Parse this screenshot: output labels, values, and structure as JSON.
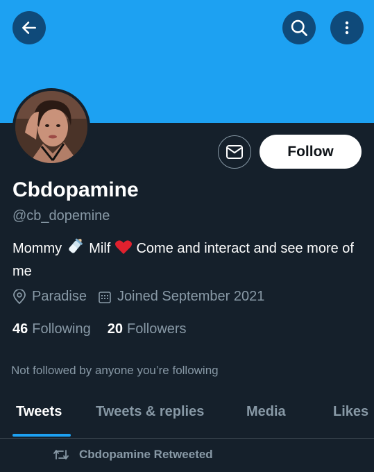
{
  "colors": {
    "background": "#15202b",
    "banner": "#1da1f2",
    "muted": "#8899a6",
    "accent": "#1da1f2"
  },
  "header": {
    "icons": [
      "back-arrow-icon",
      "search-icon",
      "more-vertical-icon"
    ]
  },
  "profile": {
    "name": "Cbdopamine",
    "handle": "@cb_dopemine",
    "bio_part1": "Mommy",
    "bio_part2": "Milf",
    "bio_part3": "Come and interact and see more of me",
    "location": "Paradise",
    "joined": "Joined September 2021",
    "following_count": "46",
    "following_label": "Following",
    "followers_count": "20",
    "followers_label": "Followers",
    "not_followed_text": "Not followed by anyone you’re following"
  },
  "actions": {
    "follow_label": "Follow"
  },
  "tabs": [
    {
      "label": "Tweets"
    },
    {
      "label": "Tweets & replies"
    },
    {
      "label": "Media"
    },
    {
      "label": "Likes"
    }
  ],
  "timeline": {
    "retweet_label": "Cbdopamine Retweeted"
  }
}
